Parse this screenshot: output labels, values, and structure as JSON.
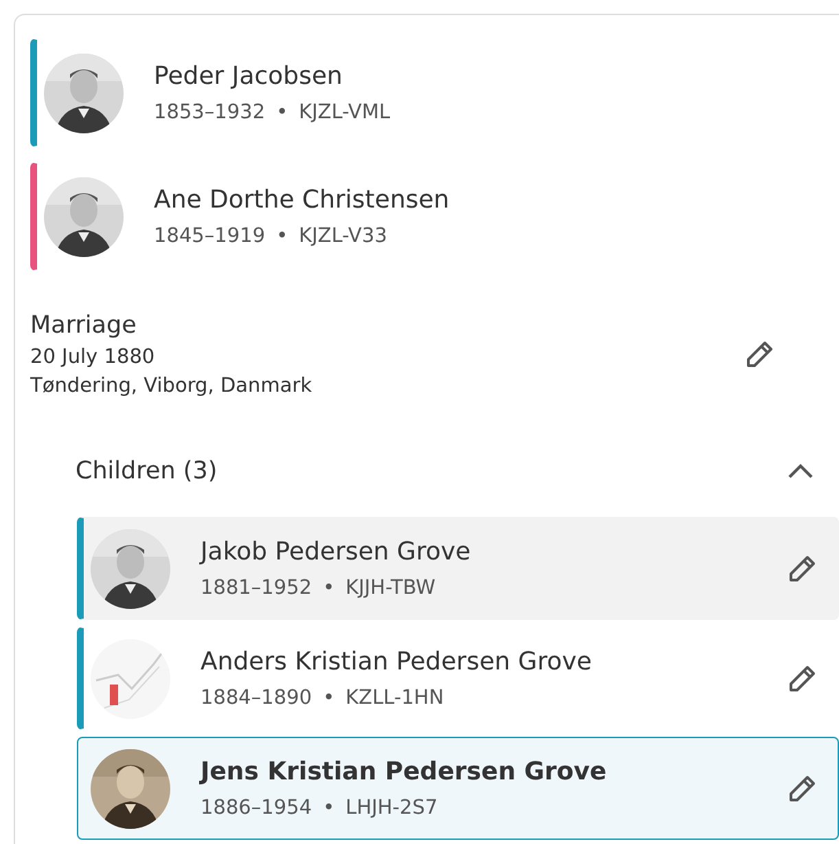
{
  "parents": [
    {
      "name": "Peder Jacobsen",
      "lifespan": "1853–1932",
      "separator": "•",
      "id": "KJZL-VML",
      "color": "#1c9bb8"
    },
    {
      "name": "Ane Dorthe Christensen",
      "lifespan": "1845–1919",
      "separator": "•",
      "id": "KJZL-V33",
      "color": "#e8527e"
    }
  ],
  "marriage": {
    "title": "Marriage",
    "date": "20 July 1880",
    "place": "Tøndering, Viborg, Danmark"
  },
  "children_section": {
    "label": "Children (3)",
    "expanded": true
  },
  "children": [
    {
      "name": "Jakob Pedersen Grove",
      "lifespan": "1881–1952",
      "separator": "•",
      "id": "KJJH-TBW",
      "color": "#1c9bb8",
      "hovered": true,
      "selected": false
    },
    {
      "name": "Anders Kristian Pedersen Grove",
      "lifespan": "1884–1890",
      "separator": "•",
      "id": "KZLL-1HN",
      "color": "#1c9bb8",
      "hovered": false,
      "selected": false
    },
    {
      "name": "Jens Kristian Pedersen Grove",
      "lifespan": "1886–1954",
      "separator": "•",
      "id": "LHJH-2S7",
      "color": "#1c9bb8",
      "hovered": false,
      "selected": true
    }
  ]
}
